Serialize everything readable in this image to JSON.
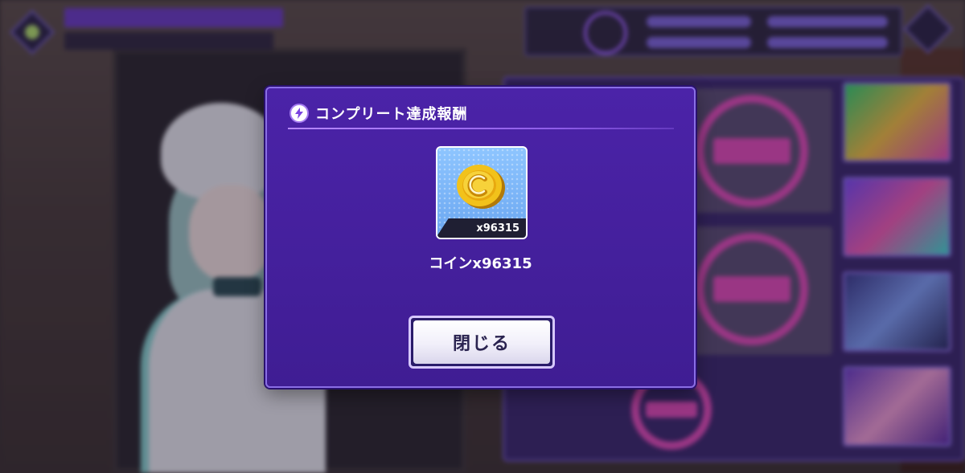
{
  "modal": {
    "title": "コンプリート達成報酬",
    "reward": {
      "icon": "coin-icon",
      "quantity_tag": "x96315",
      "name": "コインx96315"
    },
    "close_label": "閉じる"
  },
  "colors": {
    "modal_bg": "#4b23a8",
    "modal_border": "#8a6ee6",
    "accent": "#b788ff",
    "button_text": "#2a2350",
    "coin_gold": "#f2c21b",
    "clear_stamp": "#e24fb6"
  }
}
